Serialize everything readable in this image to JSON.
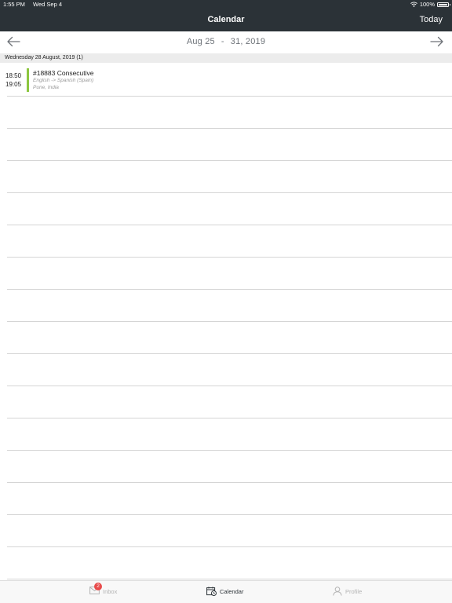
{
  "status_bar": {
    "time": "1:55 PM",
    "date": "Wed Sep 4",
    "battery": "100%"
  },
  "nav": {
    "title": "Calendar",
    "today_label": "Today"
  },
  "week": {
    "start": "Aug 25",
    "separator": "-",
    "end": "31, 2019"
  },
  "day_header": "Wednesday 28 August, 2019 (1)",
  "event": {
    "start_time": "18:50",
    "end_time": "19:05",
    "title": "#18883 Consecutive",
    "languages": "English -> Spanish (Spain)",
    "location": "Pune, India",
    "accent_color": "#8cc63f"
  },
  "tabs": {
    "inbox_label": "Inbox",
    "inbox_badge": "2",
    "calendar_label": "Calendar",
    "profile_label": "Profile"
  },
  "colors": {
    "header_bg": "#2b3237",
    "badge": "#e84c4c"
  }
}
